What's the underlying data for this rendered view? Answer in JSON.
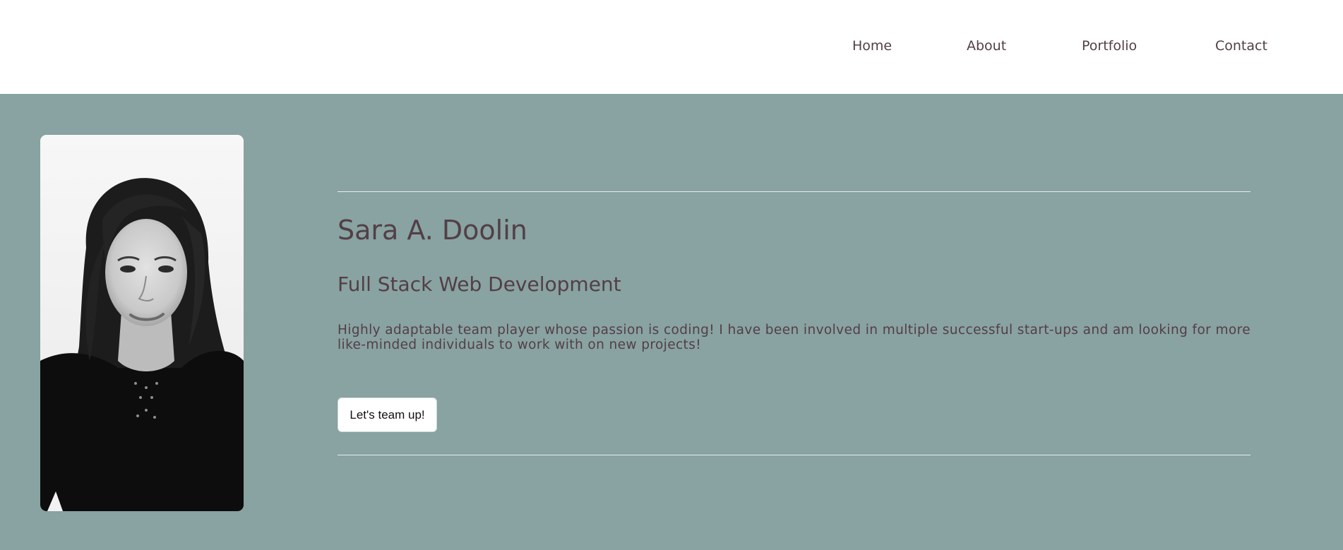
{
  "nav": {
    "items": [
      {
        "label": "Home"
      },
      {
        "label": "About"
      },
      {
        "label": "Portfolio"
      },
      {
        "label": "Contact"
      }
    ]
  },
  "hero": {
    "name": "Sara A. Doolin",
    "title": "Full Stack Web Development",
    "bio": "Highly adaptable team player whose passion is coding! I have been involved in multiple successful start-ups and am looking for more like-minded individuals to work with on new projects!",
    "cta_label": "Let's team up!"
  },
  "colors": {
    "hero_background": "#89a2a2",
    "navbar_background": "#ffffff",
    "text": "#523f46",
    "divider": "#e9eeee"
  }
}
